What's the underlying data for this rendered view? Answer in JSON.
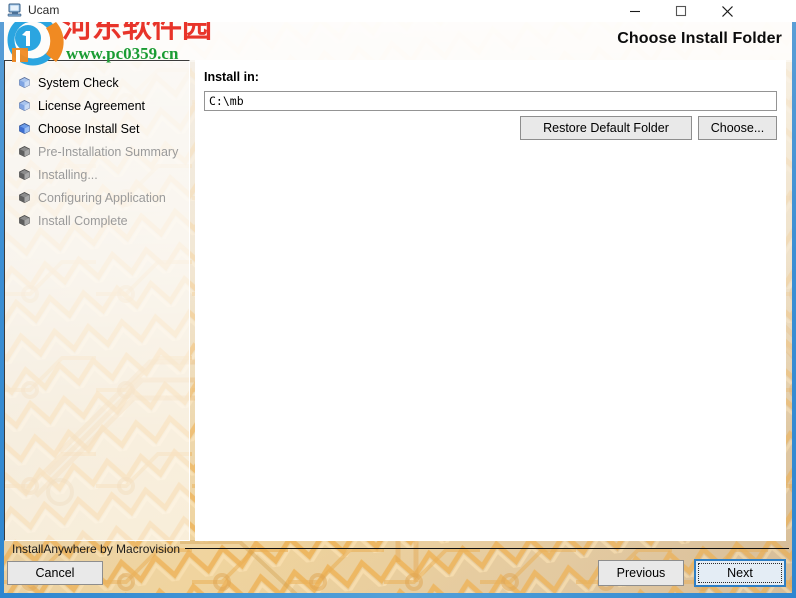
{
  "window": {
    "title": "Ucam",
    "icon": "computer-icon",
    "controls": {
      "minimize": "minimize-icon",
      "maximize": "maximize-icon",
      "close": "close-icon"
    }
  },
  "watermark": {
    "site_name": "河东软件园",
    "url": "www.pc0359.cn",
    "logo": "site-logo-icon"
  },
  "header": {
    "title": "Choose Install Folder"
  },
  "sidebar": {
    "steps": [
      {
        "label": "System Check",
        "state": "done"
      },
      {
        "label": "License Agreement",
        "state": "done"
      },
      {
        "label": "Choose Install Set",
        "state": "active"
      },
      {
        "label": "Pre-Installation Summary",
        "state": "pending"
      },
      {
        "label": "Installing...",
        "state": "pending"
      },
      {
        "label": "Configuring Application",
        "state": "pending"
      },
      {
        "label": "Install Complete",
        "state": "pending"
      }
    ]
  },
  "main": {
    "install_label": "Install in:",
    "path_value": "C:\\mb",
    "path_placeholder": "",
    "restore_button": "Restore Default Folder",
    "choose_button": "Choose..."
  },
  "footer": {
    "note": "InstallAnywhere by Macrovision",
    "cancel_button": "Cancel",
    "previous_button": "Previous",
    "next_button": "Next"
  },
  "colors": {
    "window_border_blue": "#2e86d0",
    "focus_blue": "#2f7fc4",
    "step_done": "#000000",
    "step_pending": "#9a9a9a",
    "watermark_red": "#e8342a",
    "watermark_green": "#1a9c33",
    "button_face": "#e9e9e9",
    "circuit_orange": "#e8a84e"
  }
}
